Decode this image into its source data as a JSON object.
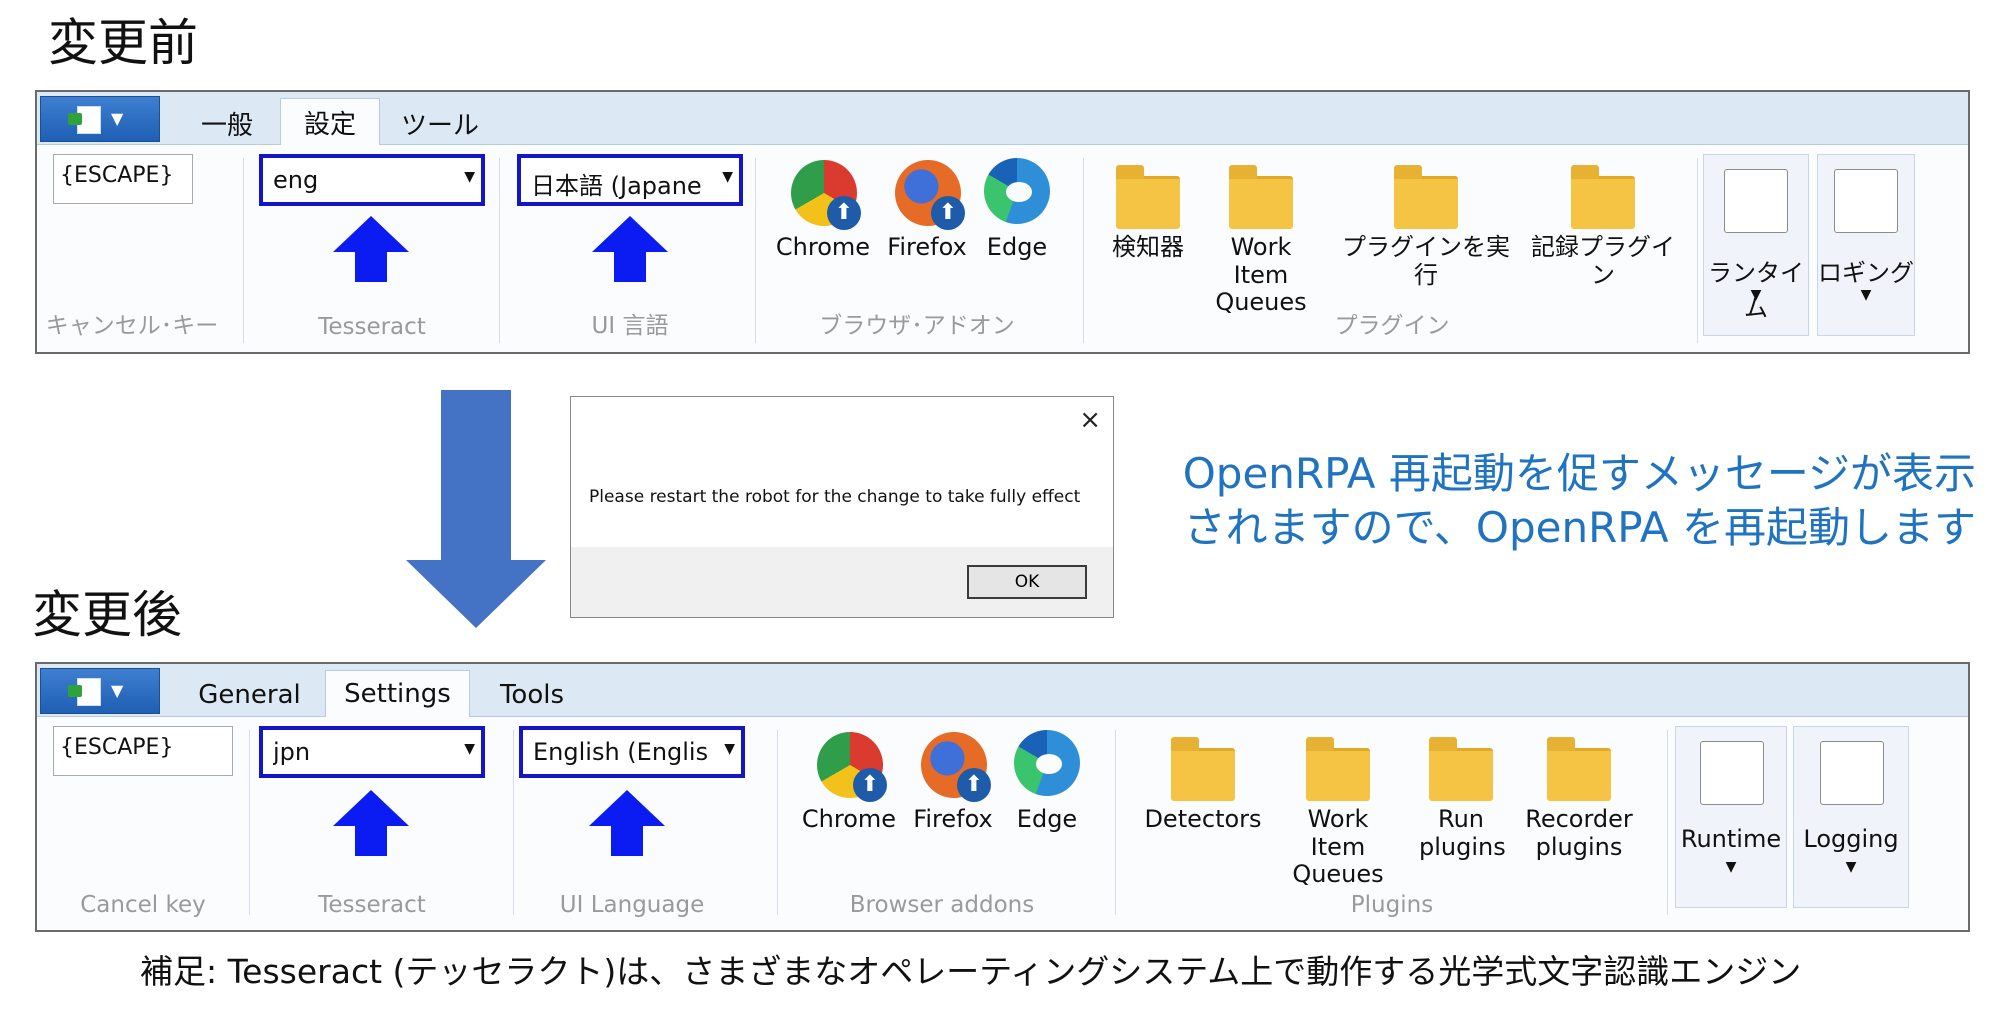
{
  "before": {
    "section_title": "変更前",
    "tabs": [
      "一般",
      "設定",
      "ツール"
    ],
    "escape_value": "{ESCAPE}",
    "groups": [
      "キャンセル･キー",
      "Tesseract",
      "UI 言語",
      "ブラウザ･アドオン",
      "プラグイン"
    ],
    "tesseract_value": "eng",
    "ui_language_value": "日本語 (Japane",
    "browser_buttons": [
      "Chrome",
      "Firefox",
      "Edge"
    ],
    "plugin_buttons": [
      "検知器",
      "Work Item Queues",
      "プラグインを実行",
      "記録プラグイン"
    ],
    "big_buttons": [
      "ランタイム",
      "ロギング"
    ]
  },
  "after": {
    "section_title": "変更後",
    "tabs": [
      "General",
      "Settings",
      "Tools"
    ],
    "escape_value": "{ESCAPE}",
    "groups": [
      "Cancel key",
      "Tesseract",
      "UI Language",
      "Browser addons",
      "Plugins"
    ],
    "tesseract_value": "jpn",
    "ui_language_value": "English (Englis",
    "browser_buttons": [
      "Chrome",
      "Firefox",
      "Edge"
    ],
    "plugin_buttons": [
      "Detectors",
      "Work Item Queues",
      "Run plugins",
      "Recorder plugins"
    ],
    "big_buttons": [
      "Runtime",
      "Logging"
    ]
  },
  "dialog": {
    "message": "Please restart the robot for the change to take fully effect",
    "ok_label": "OK",
    "close_glyph": "×"
  },
  "note": {
    "line1": "OpenRPA 再起動を促すメッセージが表示",
    "line2": "されますので、OpenRPA を再起動します"
  },
  "footnote": "補足:  Tesseract (テッセラクト)は、さまざまなオペレーティングシステム上で動作する光学式文字認識エンジン",
  "colors": {
    "highlight_border": "#1515c8",
    "arrow_blue": "#0b1cf2",
    "down_arrow": "#4472c4",
    "note_text": "#1f73c0"
  }
}
